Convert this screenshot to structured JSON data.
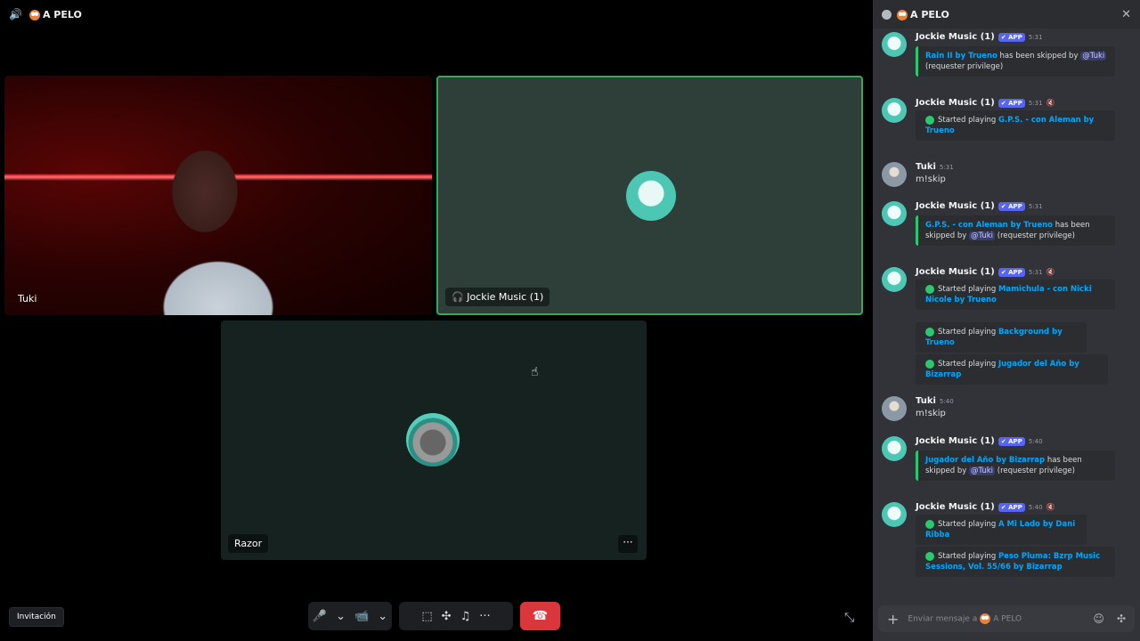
{
  "header": {
    "channel_name": "A PELO"
  },
  "tiles": {
    "cam_user": "Tuki",
    "bot_label": "Jockie Music (1)",
    "razor_label": "Razor",
    "more": "···"
  },
  "controls": {
    "invite": "Invitación",
    "mic": "🎤",
    "caret": "⌄",
    "camera": "📹",
    "share": "⬚",
    "activities": "✣",
    "soundboard": "♫",
    "more": "···",
    "hangup": "☎",
    "collapse": "⤡"
  },
  "chat": {
    "title": "A PELO",
    "close": "✕",
    "app_badge": "✔ APP",
    "messages": [
      {
        "author": "Jockie Music (1)",
        "time": "5:31",
        "embed_parts": [
          "Rain II by Trueno",
          " has been skipped by ",
          "@Tuki",
          " (requester privilege)"
        ]
      },
      {
        "author": "Jockie Music (1)",
        "time": "5:31",
        "prefix": "Started playing ",
        "link": "G.P.S. - con Aleman by Trueno"
      },
      {
        "author": "Tuki",
        "time": "5:31",
        "text": "m!skip"
      },
      {
        "author": "Jockie Music (1)",
        "time": "5:31",
        "embed_parts": [
          "G.P.S. - con Aleman by Trueno",
          " has been skipped by ",
          "@Tuki",
          " (requester privilege)"
        ]
      },
      {
        "author": "Jockie Music (1)",
        "time": "5:31",
        "prefix": "Started playing ",
        "links": [
          "Mamichula - con Nicki Nicole by Trueno",
          "Background by Trueno",
          "Jugador del Año by Bizarrap"
        ]
      },
      {
        "author": "Tuki",
        "time": "5:40",
        "text": "m!skip"
      },
      {
        "author": "Jockie Music (1)",
        "time": "5:40",
        "embed_parts": [
          "Jugador del Año by Bizarrap",
          " has been skipped by ",
          "@Tuki",
          " (requester privilege)"
        ]
      },
      {
        "author": "Jockie Music (1)",
        "time": "5:40",
        "prefix": "Started playing ",
        "links": [
          "A Mi Lado by Dani Ribba",
          "Peso Pluma: Bzrp Music Sessions, Vol. 55/66 by Bizarrap"
        ]
      }
    ],
    "input_placeholder": "Enviar mensaje a",
    "input_channel": "A PELO"
  }
}
